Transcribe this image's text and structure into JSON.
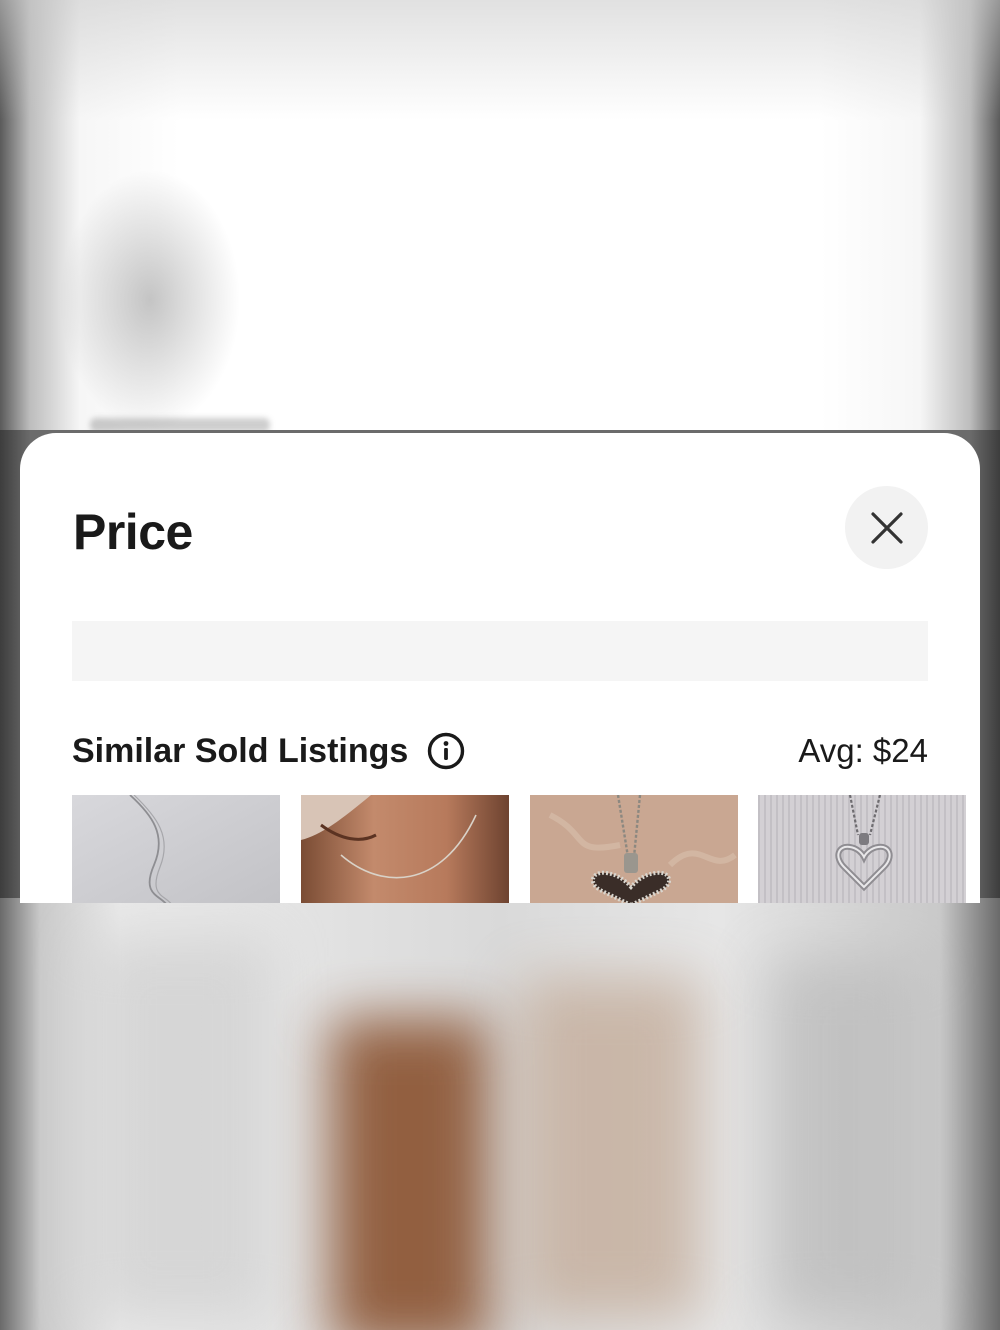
{
  "sheet": {
    "title": "Price",
    "section_title": "Similar Sold Listings",
    "average_price": "Avg: $24"
  },
  "icons": {
    "close": "close-icon",
    "info": "info-icon"
  },
  "listings": [
    {
      "image": "silver-chain-necklace"
    },
    {
      "image": "necklace-on-neck"
    },
    {
      "image": "heart-pendant-rhinestone"
    },
    {
      "image": "silver-heart-pendant"
    }
  ]
}
